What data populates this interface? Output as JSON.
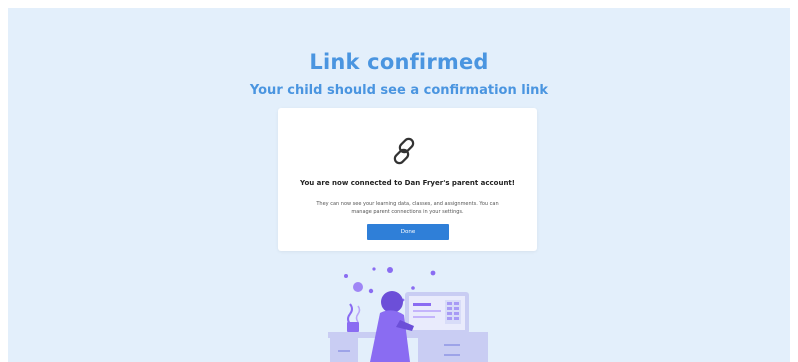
{
  "page": {
    "title": "Link confirmed",
    "subtitle": "Your child should see a confirmation link"
  },
  "card": {
    "icon": "link-icon",
    "heading": "You are now connected to Dan Fryer's parent account!",
    "body": "They can now see your learning data, classes, and assignments. You can manage parent connections in your settings.",
    "done_label": "Done"
  },
  "colors": {
    "background": "#e3effb",
    "accent": "#4a95e0",
    "button": "#2f7fd8",
    "illustration_purple": "#8a6cf2"
  }
}
